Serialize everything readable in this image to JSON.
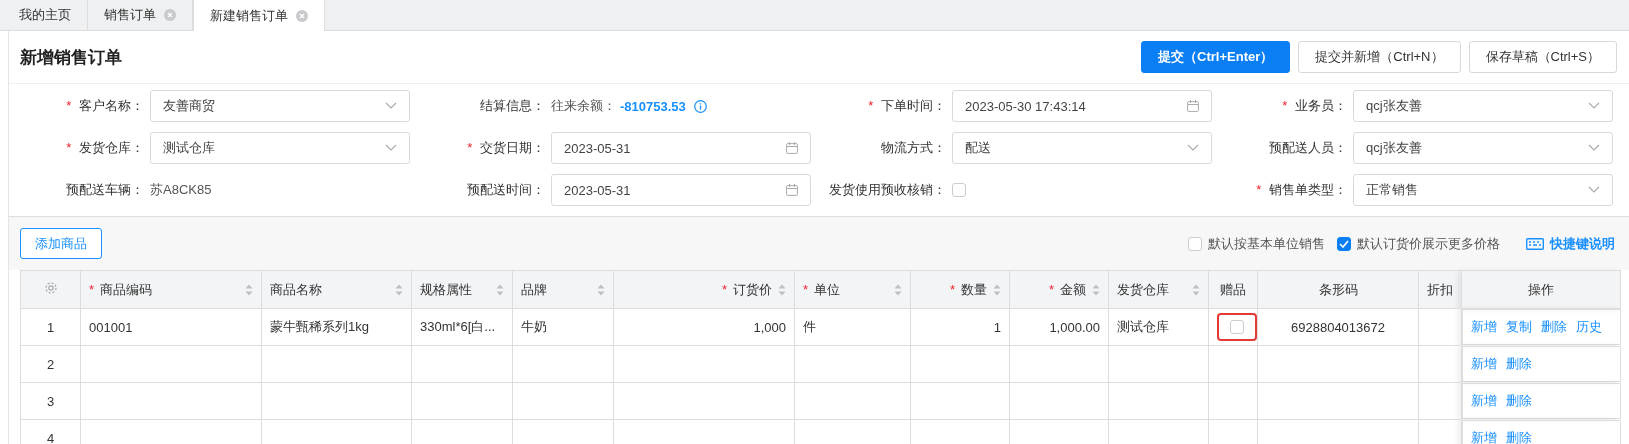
{
  "tabs": [
    {
      "label": "我的主页",
      "selected": false,
      "closable": false
    },
    {
      "label": "销售订单",
      "selected": false,
      "closable": true
    },
    {
      "label": "新建销售订单",
      "selected": true,
      "closable": true
    }
  ],
  "header": {
    "title": "新增销售订单",
    "buttons": [
      {
        "label": "提交（Ctrl+Enter）",
        "kind": "primary"
      },
      {
        "label": "提交并新增（Ctrl+N）",
        "kind": "default"
      },
      {
        "label": "保存草稿（Ctrl+S）",
        "kind": "default"
      }
    ]
  },
  "form": {
    "fields": [
      {
        "marker": "*",
        "label": "客户名称：",
        "kind": "select",
        "value": "友善商贸"
      },
      {
        "label": "结算信息：",
        "kind": "balance",
        "value": "往来余额：",
        "amount": "-810753.53"
      },
      {
        "marker": "*",
        "label": "下单时间：",
        "kind": "date",
        "value": "2023-05-30 17:43:14"
      },
      {
        "marker": "*",
        "label": "业务员：",
        "kind": "select",
        "value": "qcj张友善"
      },
      {
        "marker": "*",
        "label": "发货仓库：",
        "kind": "select",
        "value": "测试仓库"
      },
      {
        "marker": "*",
        "label": "交货日期：",
        "kind": "date",
        "value": "2023-05-31"
      },
      {
        "label": "物流方式：",
        "kind": "select",
        "value": "配送"
      },
      {
        "label": "预配送人员：",
        "kind": "select",
        "value": "qcj张友善"
      },
      {
        "label": "预配送车辆：",
        "kind": "text",
        "value": "苏A8CK85"
      },
      {
        "label": "预配送时间：",
        "kind": "date",
        "value": "2023-05-31"
      },
      {
        "label": "发货使用预收核销：",
        "kind": "checkbox",
        "checked": false
      },
      {
        "marker": "*",
        "label": "销售单类型：",
        "kind": "select",
        "value": "正常销售"
      }
    ]
  },
  "toolbar": {
    "add_button": "添加商品",
    "options": [
      {
        "label": "默认按基本单位销售",
        "checked": false
      },
      {
        "label": "默认订货价展示更多价格",
        "checked": true
      }
    ],
    "shortcut_link": "快捷键说明"
  },
  "table": {
    "columns": [
      {
        "kind": "settings"
      },
      {
        "marker": "*",
        "label": "商品编码",
        "sortable": true,
        "kind": "text"
      },
      {
        "label": "商品名称",
        "sortable": true,
        "kind": "text"
      },
      {
        "label": "规格属性",
        "sortable": true,
        "kind": "text"
      },
      {
        "label": "品牌",
        "sortable": true,
        "kind": "text"
      },
      {
        "marker": "*",
        "label": "订货价",
        "sortable": true,
        "kind": "number"
      },
      {
        "marker": "*",
        "label": "单位",
        "sortable": true,
        "kind": "text"
      },
      {
        "marker": "*",
        "label": "数量",
        "sortable": true,
        "kind": "number"
      },
      {
        "marker": "*",
        "label": "金额",
        "sortable": true,
        "kind": "number"
      },
      {
        "label": "发货仓库",
        "sortable": true,
        "kind": "text"
      },
      {
        "label": "赠品",
        "sortable": false,
        "kind": "checkbox"
      },
      {
        "label": "条形码",
        "sortable": false,
        "kind": "code"
      },
      {
        "label": "折扣",
        "sortable": false,
        "kind": "text"
      },
      {
        "label": "操作",
        "sortable": false,
        "kind": "actions"
      }
    ],
    "rows": [
      {
        "index": "1",
        "cells": [
          {
            "text": "001001"
          },
          {
            "text": "蒙牛甄稀系列1kg"
          },
          {
            "text": "330ml*6[白..."
          },
          {
            "text": "牛奶"
          },
          {
            "text": "1,000"
          },
          {
            "text": "件"
          },
          {
            "text": "1"
          },
          {
            "text": "1,000.00"
          },
          {
            "text": "测试仓库"
          },
          {
            "checked": false,
            "highlighted": true
          },
          {
            "text": "6928804013672"
          }
        ],
        "actions": [
          "新增",
          "复制",
          "删除",
          "历史"
        ]
      },
      {
        "index": "2",
        "actions": [
          "新增",
          "删除"
        ]
      },
      {
        "index": "3",
        "actions": [
          "新增",
          "删除"
        ]
      },
      {
        "index": "4",
        "actions": [
          "新增",
          "删除"
        ]
      }
    ]
  }
}
